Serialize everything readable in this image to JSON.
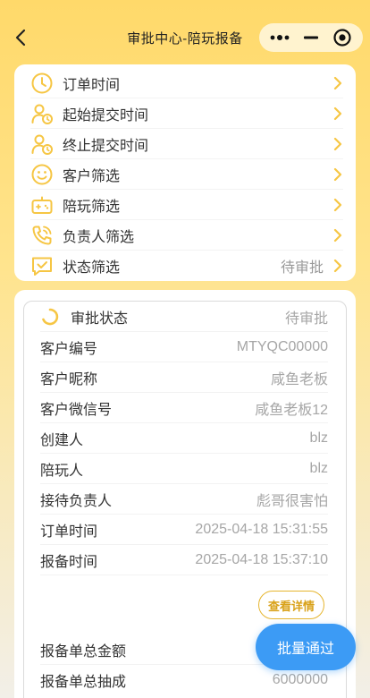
{
  "header": {
    "title": "审批中心-陪玩报备"
  },
  "colors": {
    "accent": "#F6C644",
    "fab": "#3C9BF5"
  },
  "filters": [
    {
      "icon": "clock-icon",
      "label": "订单时间",
      "value": ""
    },
    {
      "icon": "user-clock-icon",
      "label": "起始提交时间",
      "value": ""
    },
    {
      "icon": "user-clock-icon",
      "label": "终止提交时间",
      "value": ""
    },
    {
      "icon": "smile-icon",
      "label": "客户筛选",
      "value": ""
    },
    {
      "icon": "gamepad-icon",
      "label": "陪玩筛选",
      "value": ""
    },
    {
      "icon": "phone-icon",
      "label": "负责人筛选",
      "value": ""
    },
    {
      "icon": "chat-check-icon",
      "label": "状态筛选",
      "value": "待审批"
    }
  ],
  "order": {
    "status_label": "审批状态",
    "status_value": "待审批",
    "fields": [
      {
        "label": "客户编号",
        "value": "MTYQC00000"
      },
      {
        "label": "客户昵称",
        "value": "咸鱼老板"
      },
      {
        "label": "客户微信号",
        "value": "咸鱼老板12"
      },
      {
        "label": "创建人",
        "value": "blz"
      },
      {
        "label": "陪玩人",
        "value": "blz"
      },
      {
        "label": "接待负责人",
        "value": "彪哥很害怕"
      },
      {
        "label": "订单时间",
        "value": "2025-04-18 15:31:55"
      },
      {
        "label": "报备时间",
        "value": "2025-04-18 15:37:10"
      }
    ],
    "detail_button": "查看详情",
    "summary": [
      {
        "label": "报备单总金额",
        "value": ""
      },
      {
        "label": "报备单总抽成",
        "value": "6000000"
      }
    ]
  },
  "fab_label": "批量通过"
}
